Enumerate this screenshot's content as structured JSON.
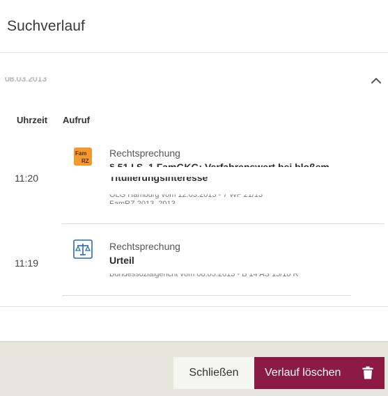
{
  "header": {
    "title": "Suchverlauf"
  },
  "group": {
    "date": "08.03.2013",
    "toggle_icon": "chevron-up-icon"
  },
  "columns": {
    "time": "Uhrzeit",
    "call": "Aufruf"
  },
  "entries": [
    {
      "time": "11:20",
      "icon": "famrz-journal-icon",
      "icon_text": "FamRZ",
      "type": "Rechtsprechung",
      "title_line1": "§ 51 I S. 1 FamGKG: Verfahrenswert bei bloßem",
      "title_line2": "Titulierungsinteresse",
      "source_line1": "OLG Hamburg vom 12.03.2013 - 7 WF 21/13",
      "source_line2": "FamRZ 2013, 2013"
    },
    {
      "time": "11:19",
      "icon": "scales-of-justice-icon",
      "type": "Rechtsprechung",
      "title_line1": "Urteil",
      "source_line1": "Bundessozialgericht vom 08.03.2013 - B 14 AS 15/10 R"
    }
  ],
  "footer": {
    "close_label": "Schließen",
    "delete_label": "Verlauf löschen",
    "delete_icon": "trash-icon"
  },
  "colors": {
    "accent": "#8c1b43",
    "footer_bg": "#e7e6dd",
    "famrz_icon": "#f29a2e",
    "scales_icon": "#2a6cb0"
  }
}
